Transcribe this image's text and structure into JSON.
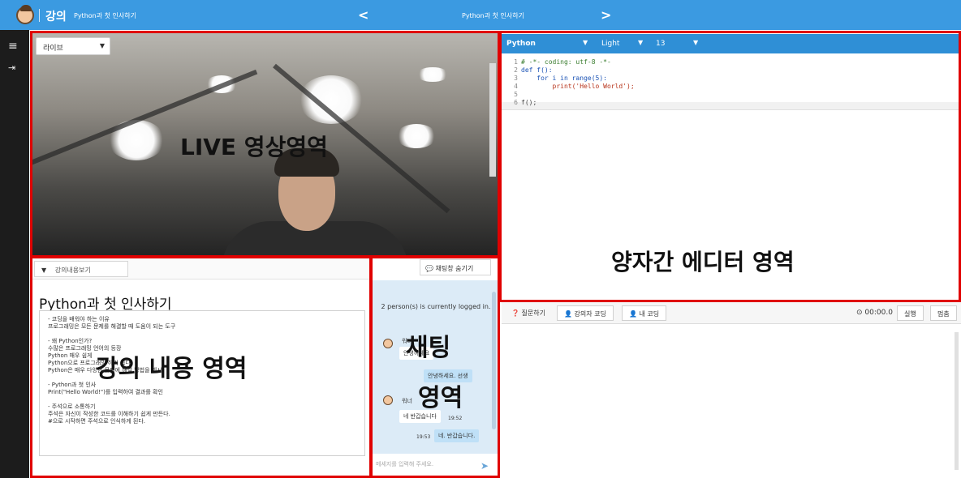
{
  "header": {
    "brand": "강의",
    "course_title": "Python과 첫 인사하기",
    "center_title": "Python과 첫 인사하기",
    "prev_symbol": "<",
    "next_symbol": ">"
  },
  "rail": {
    "items": [
      {
        "icon": "menu-icon",
        "glyph": "≡"
      },
      {
        "icon": "logout-icon",
        "glyph": "⇥"
      }
    ]
  },
  "video": {
    "source_select": "라이브",
    "overlay_label": "LIVE 영상영역"
  },
  "editor": {
    "language": "Python",
    "theme": "Light",
    "font_size": "13",
    "code_lines": [
      {
        "n": "1",
        "text": "# -*- coding: utf-8 -*-"
      },
      {
        "n": "2",
        "text": "def f():"
      },
      {
        "n": "3",
        "text": "    for i in range(5):"
      },
      {
        "n": "4",
        "text": "        print('Hello World');"
      },
      {
        "n": "5",
        "text": ""
      },
      {
        "n": "6",
        "text": "f();"
      }
    ],
    "overlay_label": "양자간 에디터 영역"
  },
  "editor_toolbar": {
    "question": "질문하기",
    "lecturer_coding": "강의자 코딩",
    "my_coding": "내 코딩",
    "timer": "00:00.0",
    "run": "실행",
    "stop": "멈춤"
  },
  "lecture": {
    "toggle_label": "강의내용보기",
    "title": "Python과 첫 인사하기",
    "lines": [
      "- 코딩을 배워야 하는 이유",
      "프로그래밍은 모든 문제를 해결할 때 도움이 되는 도구",
      "",
      "- 왜 Python인가?",
      "수많은 프로그래밍 언어의 등장",
      "Python 매우 쉽게",
      "Python으로 프로그래밍 하기 쉽다",
      "Python은 매우 다양한 문제에 해결 방법을 제시",
      "",
      "- Python과 첫 인사",
      "Print(\"Hello World!\")를 입력하여 결과를 확인",
      "",
      "- 주석으로 소통하기",
      "주석은 자신이 작성한 코드를 이해하기 쉽게 만든다.",
      "#으로 시작하면 주석으로 인식하게 된다."
    ],
    "overlay_label": "강의 내용 영역"
  },
  "chat": {
    "hide_button": "채팅창 숨기기",
    "status": "2 person(s) is currently logged in.",
    "messages": [
      {
        "name": "워너",
        "text": "안녕하세요",
        "time": "",
        "mine": false
      },
      {
        "name": "",
        "text": "안녕하세요. 선생",
        "time": "",
        "mine": true
      },
      {
        "name": "워너",
        "text": "네 반갑습니다",
        "time": "19:52",
        "mine": false
      },
      {
        "name": "",
        "text": "네. 반갑습니다.",
        "time": "19:53",
        "mine": true
      }
    ],
    "overlay_label_1": "채팅",
    "overlay_label_2": "영역",
    "input_placeholder": "메세지를 입력해 주세요."
  }
}
